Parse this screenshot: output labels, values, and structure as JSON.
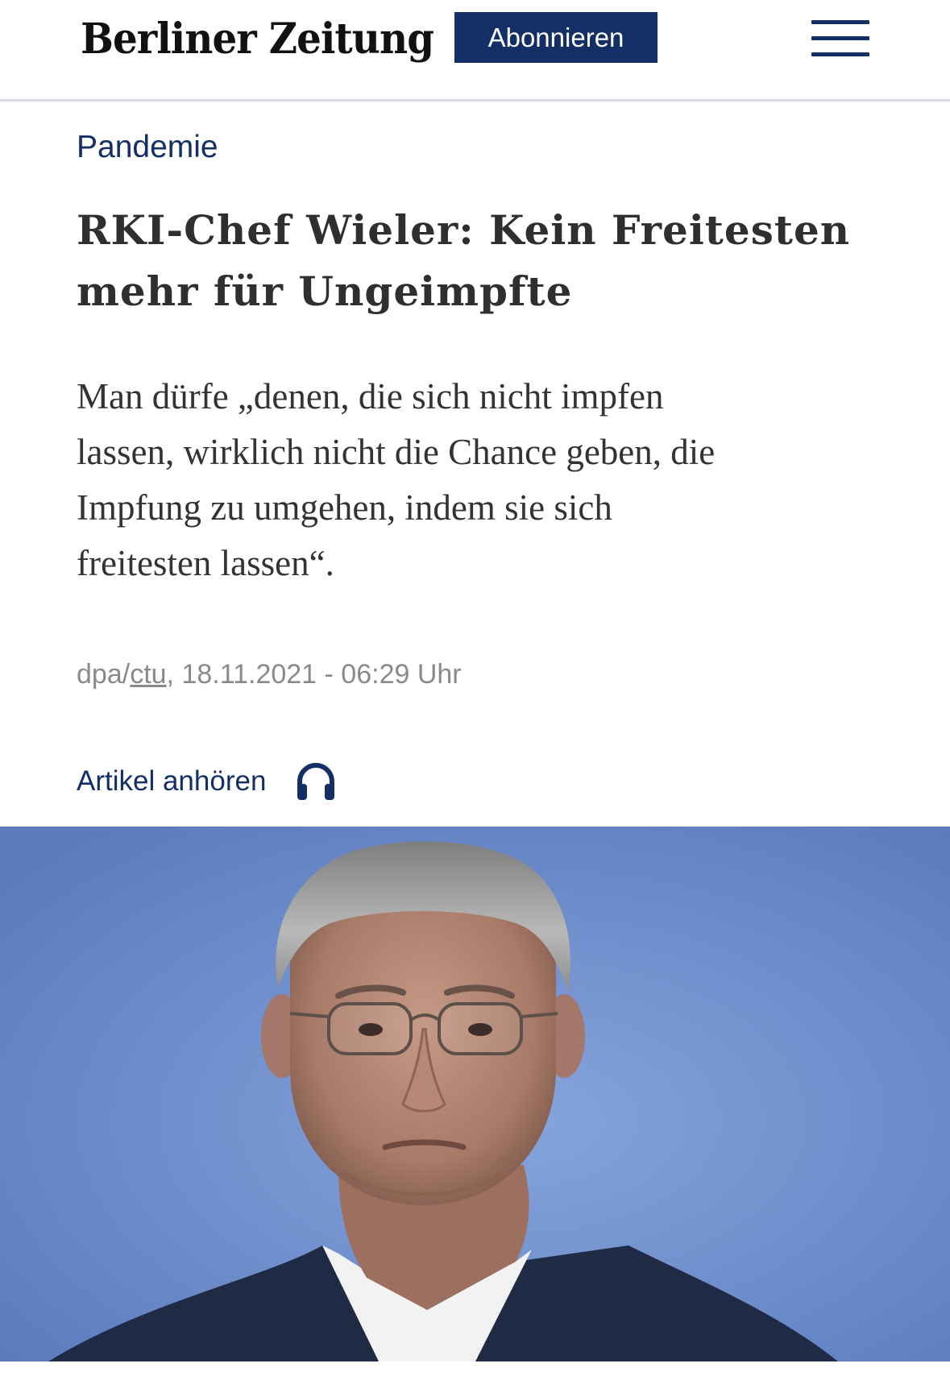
{
  "header": {
    "logo_text": "Berliner Zeitung",
    "subscribe_label": "Abonnieren",
    "menu_icon": "hamburger-menu-icon"
  },
  "article": {
    "kicker": "Pandemie",
    "headline_line1": "RKI-Chef Wieler: Kein Freitesten",
    "headline_line2": "mehr für Ungeimpfte",
    "teaser_line1": "Man dürfe „denen, die sich nicht impfen",
    "teaser_line2": "lassen, wirklich nicht die Chance geben, die",
    "teaser_line3": "Impfung zu umgehen, indem sie sich",
    "teaser_line4": "freitesten lassen“.",
    "meta": {
      "source_prefix": "dpa/",
      "author": "ctu",
      "separator": ",",
      "datetime": " 18.11.2021 - 06:29 Uhr"
    },
    "listen_label": "Artikel anhören",
    "listen_icon": "headphones-icon"
  },
  "colors": {
    "brand_navy": "#142f66",
    "text_dark": "#2f2f2f",
    "meta_gray": "#8a8a8a",
    "photo_background_blue": "#6b8ccc"
  }
}
